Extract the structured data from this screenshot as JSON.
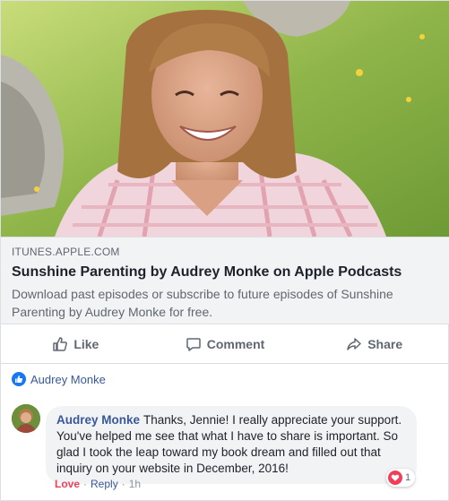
{
  "link": {
    "domain": "ITUNES.APPLE.COM",
    "title": "Sunshine Parenting by Audrey Monke on Apple Podcasts",
    "description": "Download past episodes or subscribe to future episodes of Sunshine Parenting by Audrey Monke for free."
  },
  "actions": {
    "like": "Like",
    "comment": "Comment",
    "share": "Share"
  },
  "reactions": {
    "icon": "like-icon",
    "reactors": "Audrey Monke"
  },
  "comment": {
    "author": "Audrey Monke",
    "text": "Thanks, Jennie! I really appreciate your support. You've helped me see that what I have to share is important. So glad I took the leap toward my book dream and filled out that inquiry on your website in December, 2016!",
    "reaction_count": "1",
    "love_label": "Love",
    "reply_label": "Reply",
    "time": "1h",
    "separator": "·"
  },
  "colors": {
    "link_blue": "#385898",
    "love_red": "#f33e58",
    "like_blue": "#1877f2",
    "muted": "#606770"
  }
}
